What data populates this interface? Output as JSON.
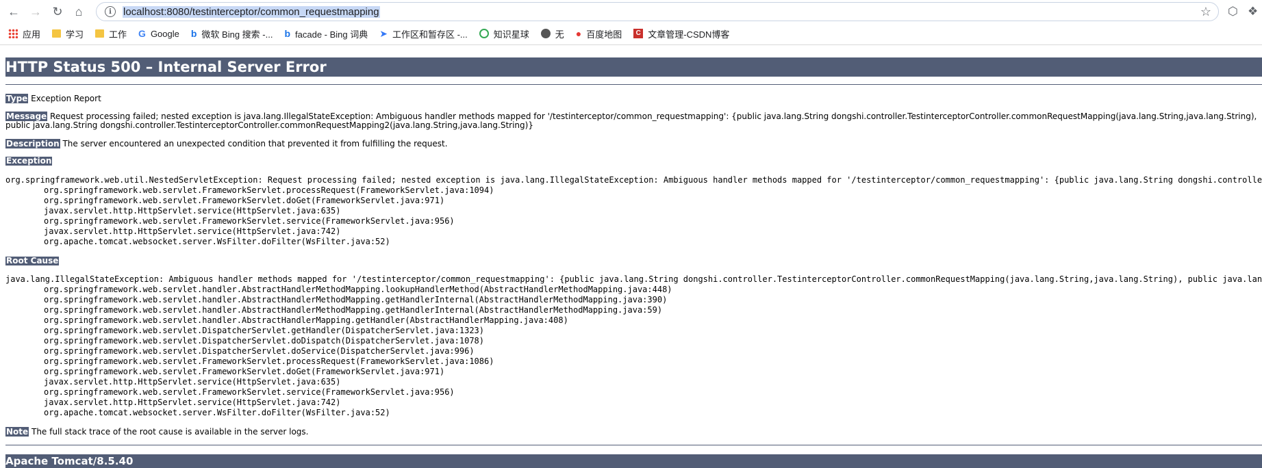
{
  "browser": {
    "url": "localhost:8080/testinterceptor/common_requestmapping",
    "bookmarks": [
      {
        "label": "应用",
        "icon": "apps-grid-icon"
      },
      {
        "label": "学习",
        "icon": "folder-icon"
      },
      {
        "label": "工作",
        "icon": "folder-icon"
      },
      {
        "label": "Google",
        "icon": "google-icon"
      },
      {
        "label": "微软 Bing 搜索 -...",
        "icon": "bing-icon"
      },
      {
        "label": "facade - Bing 词典",
        "icon": "bing-icon"
      },
      {
        "label": "工作区和暂存区 -...",
        "icon": "pin-icon"
      },
      {
        "label": "知识星球",
        "icon": "ring-icon"
      },
      {
        "label": "无",
        "icon": "globe-icon"
      },
      {
        "label": "百度地图",
        "icon": "map-pin-icon"
      },
      {
        "label": "文章管理-CSDN博客",
        "icon": "csdn-icon"
      }
    ]
  },
  "page": {
    "title": "HTTP Status 500 – Internal Server Error",
    "type_label": "Type",
    "type_value": "Exception Report",
    "message_label": "Message",
    "message_value": "Request processing failed; nested exception is java.lang.IllegalStateException: Ambiguous handler methods mapped for '/testinterceptor/common_requestmapping': {public java.lang.String dongshi.controller.TestinterceptorController.commonRequestMapping(java.lang.String,java.lang.String), public java.lang.String dongshi.controller.TestinterceptorController.commonRequestMapping2(java.lang.String,java.lang.String)}",
    "description_label": "Description",
    "description_value": "The server encountered an unexpected condition that prevented it from fulfilling the request.",
    "exception_label": "Exception",
    "exception_trace": [
      "org.springframework.web.util.NestedServletException: Request processing failed; nested exception is java.lang.IllegalStateException: Ambiguous handler methods mapped for '/testinterceptor/common_requestmapping': {public java.lang.String dongshi.controller.TestinterceptorController.commonRequestMapping(java.lang.String,java.lang.String), public java.lang.String dongshi.controller.TestinterceptorController.commonRequestMapping2(java.lang.String,java.lang.String)}",
      "org.springframework.web.servlet.FrameworkServlet.processRequest(FrameworkServlet.java:1094)",
      "org.springframework.web.servlet.FrameworkServlet.doGet(FrameworkServlet.java:971)",
      "javax.servlet.http.HttpServlet.service(HttpServlet.java:635)",
      "org.springframework.web.servlet.FrameworkServlet.service(FrameworkServlet.java:956)",
      "javax.servlet.http.HttpServlet.service(HttpServlet.java:742)",
      "org.apache.tomcat.websocket.server.WsFilter.doFilter(WsFilter.java:52)"
    ],
    "root_cause_label": "Root Cause",
    "root_cause_trace": [
      "java.lang.IllegalStateException: Ambiguous handler methods mapped for '/testinterceptor/common_requestmapping': {public java.lang.String dongshi.controller.TestinterceptorController.commonRequestMapping(java.lang.String,java.lang.String), public java.lang.String dongshi.controller.TestinterceptorController.commonRequestMapping2(java.lang.String,java.lang.String)}",
      "org.springframework.web.servlet.handler.AbstractHandlerMethodMapping.lookupHandlerMethod(AbstractHandlerMethodMapping.java:448)",
      "org.springframework.web.servlet.handler.AbstractHandlerMethodMapping.getHandlerInternal(AbstractHandlerMethodMapping.java:390)",
      "org.springframework.web.servlet.handler.AbstractHandlerMethodMapping.getHandlerInternal(AbstractHandlerMethodMapping.java:59)",
      "org.springframework.web.servlet.handler.AbstractHandlerMapping.getHandler(AbstractHandlerMapping.java:408)",
      "org.springframework.web.servlet.DispatcherServlet.getHandler(DispatcherServlet.java:1323)",
      "org.springframework.web.servlet.DispatcherServlet.doDispatch(DispatcherServlet.java:1078)",
      "org.springframework.web.servlet.DispatcherServlet.doService(DispatcherServlet.java:996)",
      "org.springframework.web.servlet.FrameworkServlet.processRequest(FrameworkServlet.java:1086)",
      "org.springframework.web.servlet.FrameworkServlet.doGet(FrameworkServlet.java:971)",
      "javax.servlet.http.HttpServlet.service(HttpServlet.java:635)",
      "org.springframework.web.servlet.FrameworkServlet.service(FrameworkServlet.java:956)",
      "javax.servlet.http.HttpServlet.service(HttpServlet.java:742)",
      "org.apache.tomcat.websocket.server.WsFilter.doFilter(WsFilter.java:52)"
    ],
    "note_label": "Note",
    "note_value": "The full stack trace of the root cause is available in the server logs.",
    "footer": "Apache Tomcat/8.5.40"
  },
  "colors": {
    "tomcat_header": "#525d76"
  }
}
